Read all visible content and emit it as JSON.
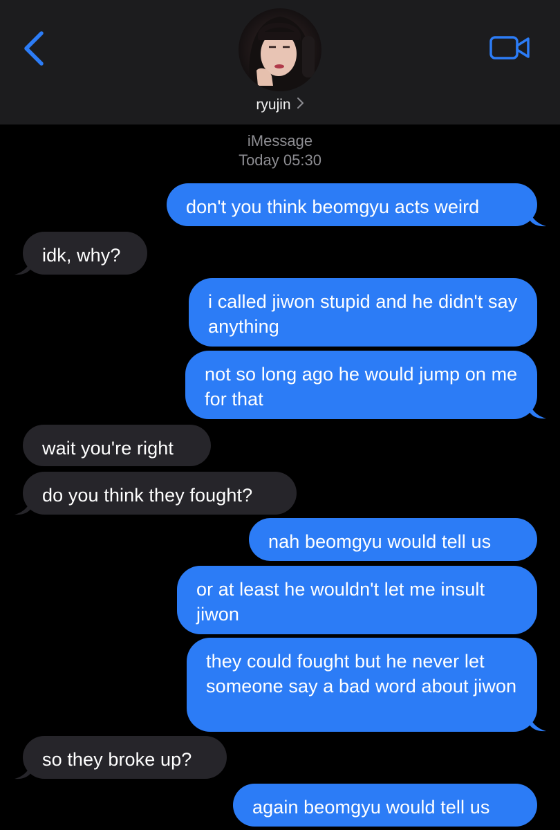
{
  "header": {
    "contact_name": "ryujin",
    "back_icon": "chevron-left-icon",
    "video_icon": "video-camera-icon",
    "accent_color": "#2c7cf6"
  },
  "thread": {
    "service": "iMessage",
    "timestamp": "Today 05:30"
  },
  "messages": [
    {
      "from": "me",
      "text": "don't you think beomgyu acts weird"
    },
    {
      "from": "them",
      "text": "idk, why?"
    },
    {
      "from": "me",
      "text": "i called jiwon stupid and he didn't say anything"
    },
    {
      "from": "me",
      "text": "not so long ago he would jump on me for that"
    },
    {
      "from": "them",
      "text": "wait you're right"
    },
    {
      "from": "them",
      "text": "do you think they fought?"
    },
    {
      "from": "me",
      "text": "nah beomgyu would tell us"
    },
    {
      "from": "me",
      "text": "or at least he wouldn't let me insult jiwon"
    },
    {
      "from": "me",
      "text": "they could fought but he never let someone say a bad word about jiwon"
    },
    {
      "from": "them",
      "text": "so they broke up?"
    },
    {
      "from": "me",
      "text": "again beomgyu would tell us"
    }
  ]
}
